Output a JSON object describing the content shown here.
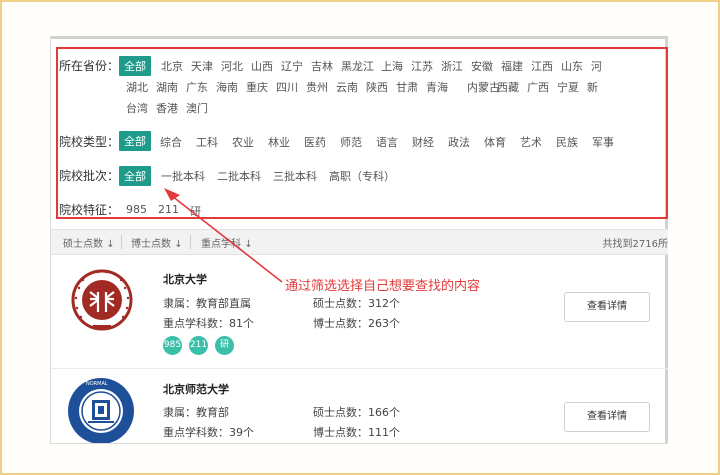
{
  "filters": {
    "province": {
      "label": "所在省份：",
      "selected": "全部",
      "row1": [
        "北京",
        "天津",
        "河北",
        "山西",
        "辽宁",
        "吉林",
        "黑龙江",
        "上海",
        "江苏",
        "浙江",
        "安徽",
        "福建",
        "江西",
        "山东",
        "河"
      ],
      "row2": [
        "湖北",
        "湖南",
        "广东",
        "海南",
        "重庆",
        "四川",
        "贵州",
        "云南",
        "陕西",
        "甘肃",
        "青海",
        "内蒙古",
        "西藏",
        "广西",
        "宁夏",
        "新"
      ],
      "row3": [
        "台湾",
        "香港",
        "澳门"
      ]
    },
    "type": {
      "label": "院校类型：",
      "selected": "全部",
      "options": [
        "综合",
        "工科",
        "农业",
        "林业",
        "医药",
        "师范",
        "语言",
        "财经",
        "政法",
        "体育",
        "艺术",
        "民族",
        "军事"
      ]
    },
    "batch": {
      "label": "院校批次：",
      "selected": "全部",
      "options": [
        "一批本科",
        "二批本科",
        "三批本科",
        "高职（专科）"
      ]
    },
    "feature": {
      "label": "院校特征：",
      "options": [
        "985",
        "211",
        "研"
      ]
    }
  },
  "sortbar": {
    "items": [
      "硕士点数",
      "博士点数",
      "重点学科"
    ],
    "sort_icon": "arrow-down-icon",
    "found_text": "共找到2716所"
  },
  "universities": [
    {
      "name": "北京大学",
      "affiliation": "隶属：教育部直属",
      "key_disciplines": "重点学科数：81个",
      "masters": "硕士点数：312个",
      "doctors": "博士点数：263个",
      "badges": [
        "985",
        "211",
        "研"
      ],
      "button": "查看详情"
    },
    {
      "name": "北京师范大学",
      "affiliation": "隶属：教育部",
      "key_disciplines": "重点学科数：39个",
      "masters": "硕士点数：166个",
      "doctors": "博士点数：111个",
      "button": "查看详情"
    }
  ],
  "annotation": {
    "text": "通过筛选选择自己想要查找的内容",
    "color": "#e23a3a"
  },
  "colors": {
    "accent": "#1e9b8a",
    "badge": "#3bbfa8",
    "highlight": "#e23a3a",
    "frame": "#f0cf86"
  }
}
